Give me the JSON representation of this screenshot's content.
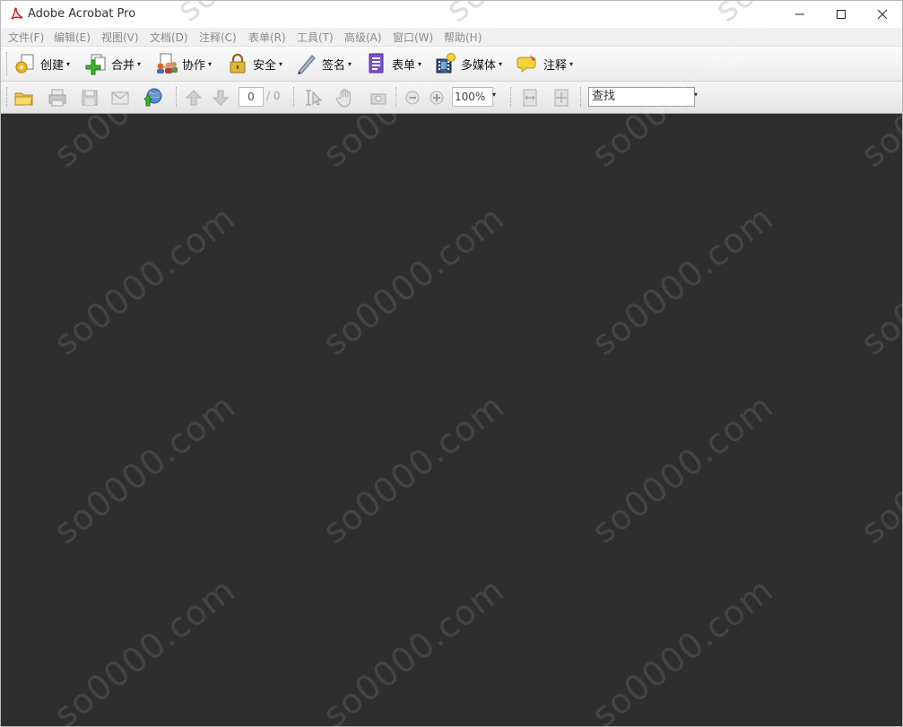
{
  "window": {
    "title": "Adobe Acrobat Pro"
  },
  "menu": [
    {
      "label": "文件(F)"
    },
    {
      "label": "编辑(E)"
    },
    {
      "label": "视图(V)"
    },
    {
      "label": "文档(D)"
    },
    {
      "label": "注释(C)"
    },
    {
      "label": "表单(R)"
    },
    {
      "label": "工具(T)"
    },
    {
      "label": "高级(A)"
    },
    {
      "label": "窗口(W)"
    },
    {
      "label": "帮助(H)"
    }
  ],
  "toolbar": {
    "create": "创建",
    "combine": "合并",
    "collaborate": "协作",
    "secure": "安全",
    "sign": "签名",
    "forms": "表单",
    "multimedia": "多媒体",
    "comment": "注释",
    "dropdown_glyph": "▾"
  },
  "nav": {
    "page_value": "0",
    "page_total": "/ 0",
    "zoom_value": "100%",
    "find_value": "查找"
  },
  "watermark": {
    "text": "so0000.com"
  },
  "colors": {
    "document_bg": "#2e2e2e",
    "menu_text": "#8a8a8a",
    "pdf_red": "#d2171b"
  }
}
